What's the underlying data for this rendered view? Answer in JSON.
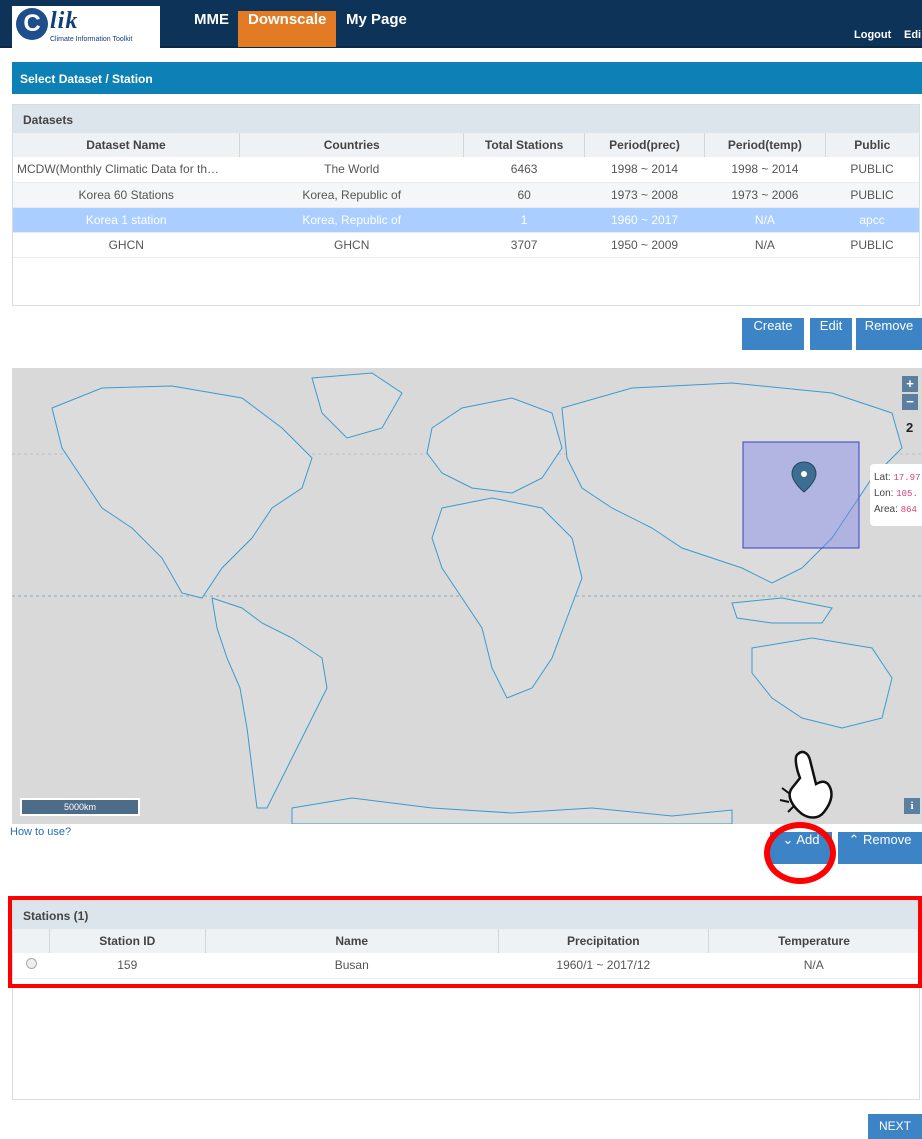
{
  "app": {
    "logo_letter": "C",
    "logo_word": "lik",
    "logo_sub": "Climate Information Toolkit",
    "nav": [
      "MME",
      "Downscale",
      "My Page"
    ],
    "logout": "Logout",
    "edit": "Edi"
  },
  "header": {
    "title": "Select Dataset / Station"
  },
  "datasets": {
    "title": "Datasets",
    "columns": [
      "Dataset Name",
      "Countries",
      "Total Stations",
      "Period(prec)",
      "Period(temp)",
      "Public"
    ],
    "rows": [
      [
        "MCDW(Monthly Climatic Data for th…",
        "The World",
        "6463",
        "1998 ~ 2014",
        "1998 ~ 2014",
        "PUBLIC"
      ],
      [
        "Korea 60 Stations",
        "Korea, Republic of",
        "60",
        "1973 ~ 2008",
        "1973 ~ 2006",
        "PUBLIC"
      ],
      [
        "Korea 1 station",
        "Korea, Republic of",
        "1",
        "1960 ~ 2017",
        "N/A",
        "apcc"
      ],
      [
        "GHCN",
        "GHCN",
        "3707",
        "1950 ~ 2009",
        "N/A",
        "PUBLIC"
      ]
    ],
    "selected_index": 2
  },
  "dataset_buttons": {
    "create": "Create",
    "edit": "Edit",
    "remove": "Remove"
  },
  "map": {
    "zoom_in": "+",
    "zoom_out": "−",
    "count": "2",
    "scale": "5000km",
    "info": "i",
    "popup": {
      "lat_label": "Lat:",
      "lat_value": "17.97",
      "lon_label": "Lon:",
      "lon_value": "105.",
      "area_label": "Area:",
      "area_value": "864"
    }
  },
  "how_to_use": "How to use?",
  "station_buttons": {
    "add": "Add",
    "remove": "Remove"
  },
  "stations": {
    "title": "Stations (1)",
    "columns": [
      "Station ID",
      "Name",
      "Precipitation",
      "Temperature"
    ],
    "rows": [
      [
        "159",
        "Busan",
        "1960/1 ~ 2017/12",
        "N/A"
      ]
    ]
  },
  "next": "NEXT",
  "colors": {
    "topbar": "#0d3358",
    "accent": "#e37a24",
    "panel": "#0d80b5",
    "button": "#3c84c6",
    "selected_row": "#a9ceff",
    "highlight": "#ff0000"
  }
}
